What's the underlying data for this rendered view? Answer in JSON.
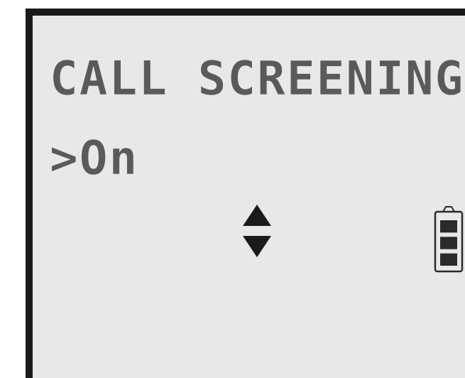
{
  "screen": {
    "title": "CALL SCREENING",
    "selected_option": ">On"
  },
  "icons": {
    "navigation": "up-down-arrows-icon",
    "battery": "battery-icon"
  },
  "battery": {
    "level_bars": 3,
    "max_bars": 3
  },
  "colors": {
    "lcd_background": "#e8e8e8",
    "lcd_text": "#5a5a5a",
    "bezel": "#1a1a1a"
  }
}
